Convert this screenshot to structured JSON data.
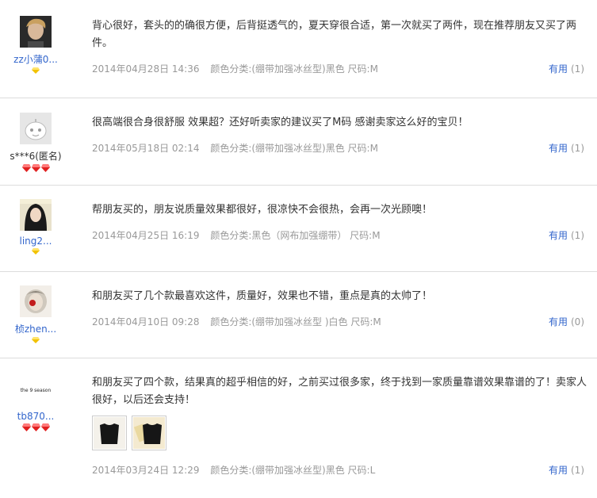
{
  "reviews": [
    {
      "username": "zz小蒲0...",
      "avatar_icon": "user-photo-icon",
      "badge": "gold-diamond",
      "content": "背心很好，套头的的确很方便，后背挺透气的，夏天穿很合适，第一次就买了两件，现在推荐朋友又买了两件。",
      "date": "2014年04月28日 14:36",
      "sku": "颜色分类:(绷带加强冰丝型)黑色  尺码:M",
      "useful_label": "有用",
      "useful_count": "(1)"
    },
    {
      "username": "s***6(匿名)",
      "avatar_icon": "anonymous-avatar-icon",
      "badge": "red-hearts",
      "content": "很高端很合身很舒服 效果超？还好听卖家的建议买了M码 感谢卖家这么好的宝贝！",
      "date": "2014年05月18日 02:14",
      "sku": "颜色分类:(绷带加强冰丝型)黑色  尺码:M",
      "useful_label": "有用",
      "useful_count": "(1)"
    },
    {
      "username": "ling2...",
      "avatar_icon": "user-photo-icon",
      "badge": "gold-diamond",
      "content": "帮朋友买的，朋友说质量效果都很好，很凉快不会很热，会再一次光顾噢！",
      "date": "2014年04月25日 16:19",
      "sku": "颜色分类:黑色（网布加强绷带）  尺码:M",
      "useful_label": "有用",
      "useful_count": "(1)"
    },
    {
      "username": "桢zhen...",
      "avatar_icon": "user-photo-icon",
      "badge": "gold-diamond",
      "content": "和朋友买了几个款最喜欢这件，质量好，效果也不错，重点是真的太帅了！",
      "date": "2014年04月10日 09:28",
      "sku": "颜色分类:(绷带加强冰丝型 )白色  尺码:M",
      "useful_label": "有用",
      "useful_count": "(0)"
    },
    {
      "username": "tb870...",
      "avatar_icon": "user-logo-icon",
      "avatar_text": "the 9 season",
      "badge": "red-hearts",
      "content": "和朋友买了四个款，结果真的超乎相信的好，之前买过很多家，终于找到一家质量靠谱效果靠谱的了！卖家人很好，以后还会支持！",
      "date": "2014年03月24日 12:29",
      "sku": "颜色分类:(绷带加强冰丝型)黑色  尺码:L",
      "useful_label": "有用",
      "useful_count": "(1)",
      "photos": [
        "black-vest-photo-icon",
        "black-vest-photo-icon"
      ]
    }
  ],
  "colors": {
    "link": "#3366cc",
    "meta": "#999999",
    "divider": "#dcdcdc",
    "badge_gold": "#f2c200",
    "badge_red": "#e02020"
  }
}
